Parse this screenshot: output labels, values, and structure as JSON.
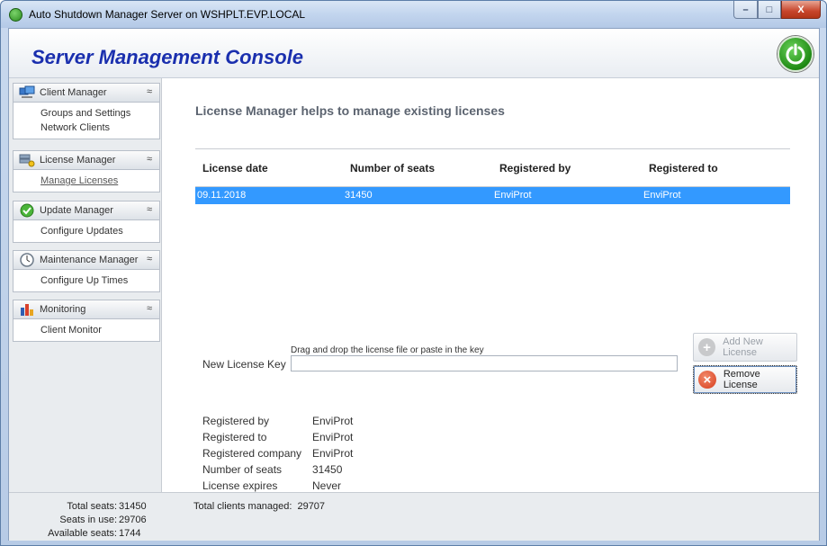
{
  "window": {
    "title": "Auto Shutdown Manager Server on WSHPLT.EVP.LOCAL",
    "min_glyph": "–",
    "max_glyph": "□",
    "close_glyph": "X"
  },
  "header": {
    "title": "Server Management Console"
  },
  "sidebar": {
    "chevron": "≈",
    "groups": [
      {
        "label": "Client Manager",
        "icon": "computers-icon",
        "items": [
          "Groups and Settings",
          "Network Clients"
        ]
      },
      {
        "label": "License Manager",
        "icon": "license-server-icon",
        "items": [
          "Manage Licenses"
        ]
      },
      {
        "label": "Update Manager",
        "icon": "update-check-icon",
        "items": [
          "Configure Updates"
        ]
      },
      {
        "label": "Maintenance Manager",
        "icon": "clock-icon",
        "items": [
          "Configure Up Times"
        ]
      },
      {
        "label": "Monitoring",
        "icon": "bar-chart-icon",
        "items": [
          "Client Monitor"
        ]
      }
    ]
  },
  "main": {
    "heading": "License Manager helps to manage existing licenses",
    "table": {
      "columns": [
        "License date",
        "Number of seats",
        "Registered by",
        "Registered to"
      ],
      "rows": [
        [
          "09.11.2018",
          "31450",
          "EnviProt",
          "EnviProt"
        ]
      ]
    },
    "new_key": {
      "hint": "Drag and drop the license file or paste in the key",
      "label": "New License Key",
      "value": ""
    },
    "buttons": {
      "add": "Add New License",
      "remove": "Remove License"
    },
    "details": [
      {
        "label": "Registered  by",
        "value": "EnviProt"
      },
      {
        "label": "Registered to",
        "value": "EnviProt"
      },
      {
        "label": "Registered company",
        "value": "EnviProt"
      },
      {
        "label": "Number of seats",
        "value": "31450"
      },
      {
        "label": "License expires",
        "value": "Never"
      }
    ]
  },
  "footer": {
    "stats": [
      {
        "label": "Total seats:",
        "value": "31450"
      },
      {
        "label": "Seats in use:",
        "value": "29706"
      },
      {
        "label": "Available seats:",
        "value": "1744"
      }
    ],
    "managed_label": "Total clients managed:",
    "managed_value": "29707"
  }
}
